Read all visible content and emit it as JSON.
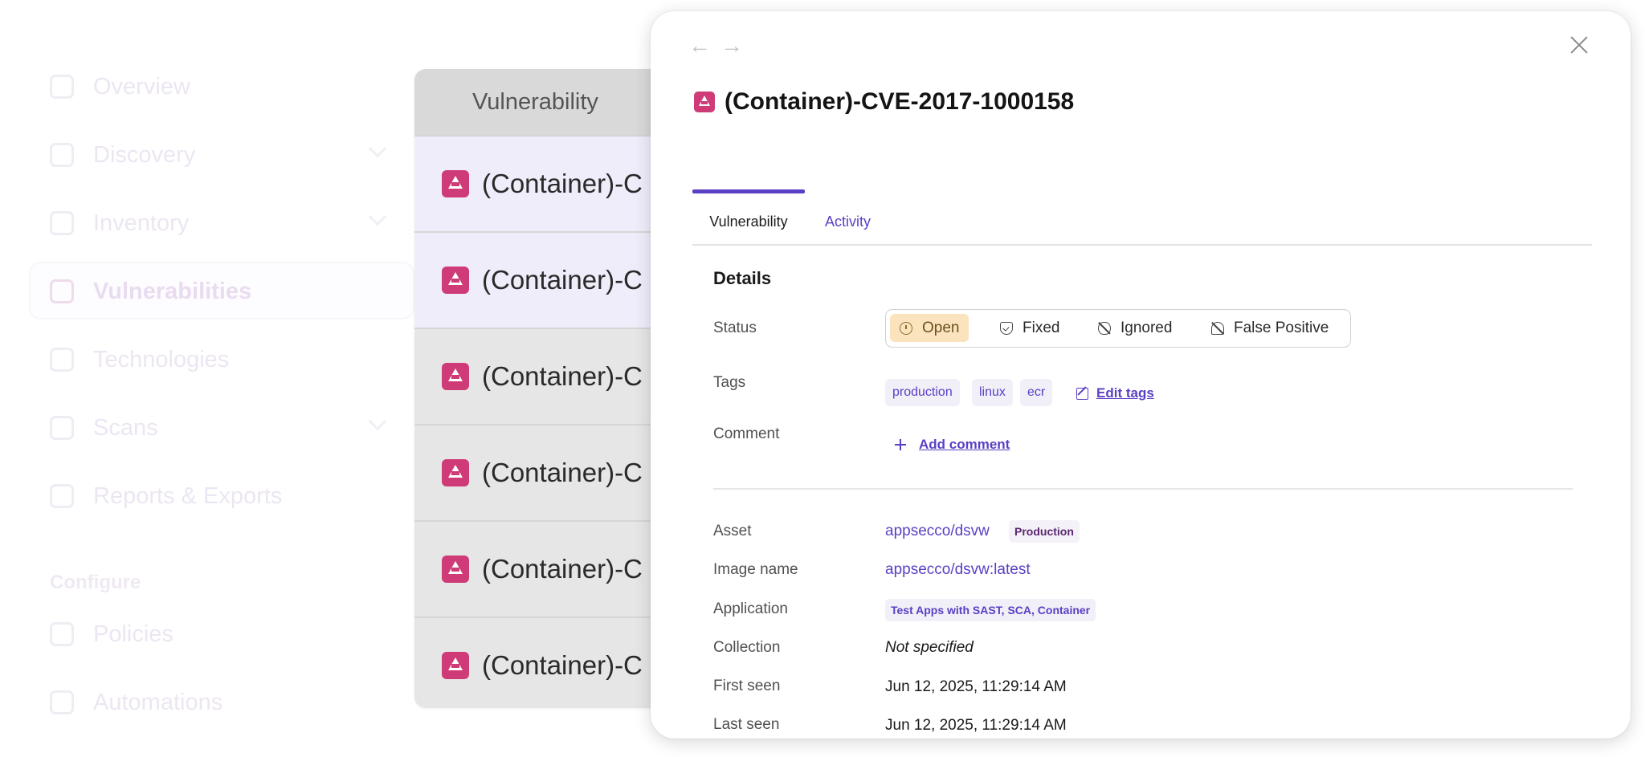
{
  "sidebar": {
    "items": [
      {
        "label": "Overview"
      },
      {
        "label": "Discovery"
      },
      {
        "label": "Inventory"
      },
      {
        "label": "Vulnerabilities"
      },
      {
        "label": "Technologies"
      },
      {
        "label": "Scans"
      },
      {
        "label": "Reports & Exports"
      }
    ],
    "section_configure": "Configure",
    "config_items": [
      {
        "label": "Policies"
      },
      {
        "label": "Automations"
      }
    ]
  },
  "table": {
    "header": "Vulnerability",
    "rows": [
      {
        "text": "(Container)-C"
      },
      {
        "text": "(Container)-C"
      },
      {
        "text": "(Container)-C"
      },
      {
        "text": "(Container)-C"
      },
      {
        "text": "(Container)-C"
      },
      {
        "text": "(Container)-C"
      }
    ]
  },
  "drawer": {
    "title": "(Container)-CVE-2017-1000158",
    "tabs": [
      {
        "label": "Vulnerability"
      },
      {
        "label": "Activity"
      }
    ],
    "details_title": "Details",
    "labels": {
      "status": "Status",
      "tags": "Tags",
      "comment": "Comment",
      "asset": "Asset",
      "image_name": "Image name",
      "application": "Application",
      "collection": "Collection",
      "first_seen": "First seen",
      "last_seen": "Last seen"
    },
    "status_options": [
      {
        "label": "Open",
        "selected": true
      },
      {
        "label": "Fixed"
      },
      {
        "label": "Ignored"
      },
      {
        "label": "False Positive"
      }
    ],
    "tags": [
      "production",
      "linux",
      "ecr"
    ],
    "edit_tags": "Edit tags",
    "add_comment": "Add comment",
    "asset": "appsecco/dsvw",
    "asset_badge": "Production",
    "image_name": "appsecco/dsvw:latest",
    "application": "Test Apps with SAST, SCA, Container",
    "collection": "Not specified",
    "first_seen": "Jun 12, 2025, 11:29:14 AM",
    "last_seen": "Jun 12, 2025, 11:29:14 AM"
  },
  "colors": {
    "accent": "#5b3fc4",
    "severity": "#cf3b76",
    "status_open_bg": "#fbe4bd"
  }
}
